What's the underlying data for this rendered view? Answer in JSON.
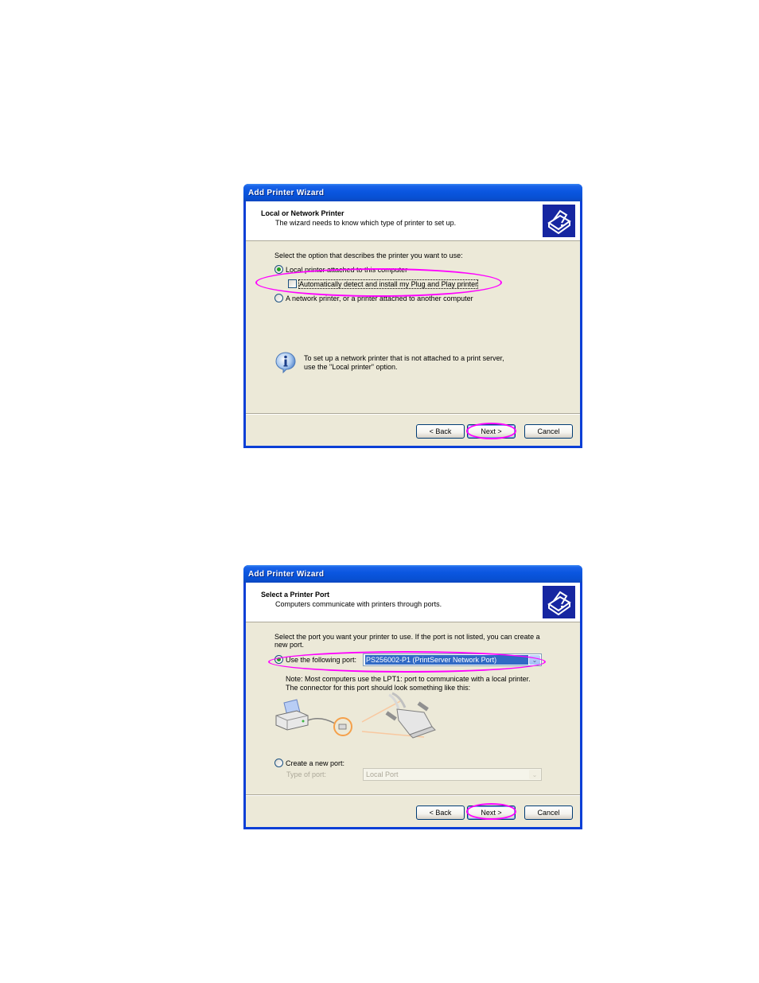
{
  "dialogs": [
    {
      "window_title": "Add Printer Wizard",
      "header": {
        "title": "Local or Network Printer",
        "subtitle": "The wizard needs to know which type of printer to set up."
      },
      "prompt": "Select the option that describes the printer you want to use:",
      "options": [
        {
          "label": "Local printer attached to this computer",
          "type": "radio",
          "checked": true
        },
        {
          "label": "Automatically detect and install my Plug and Play printer",
          "type": "checkbox",
          "checked": false
        },
        {
          "label": "A network printer, or a printer attached to another computer",
          "type": "radio",
          "checked": false
        }
      ],
      "info_text_line1": "To set up a network printer that is not attached to a print server,",
      "info_text_line2": "use the \"Local printer\" option.",
      "buttons": {
        "back": "< Back",
        "next": "Next >",
        "cancel": "Cancel"
      }
    },
    {
      "window_title": "Add Printer Wizard",
      "header": {
        "title": "Select a Printer Port",
        "subtitle": "Computers communicate with printers through ports."
      },
      "prompt_line1": "Select the port you want your printer to use.  If the port is not listed, you can create a",
      "prompt_line2": "new port.",
      "use_port": {
        "label": "Use the following port:",
        "checked": true,
        "selected_value": "PS256002-P1 (PrintServer Network Port)"
      },
      "note_line1": "Note: Most computers use the LPT1: port to communicate with a local printer.",
      "note_line2": "The connector for this port should look something like this:",
      "create_port": {
        "label": "Create a new port:",
        "checked": false,
        "type_label": "Type of port:",
        "type_value": "Local Port"
      },
      "buttons": {
        "back": "< Back",
        "next": "Next >",
        "cancel": "Cancel"
      }
    }
  ],
  "annotation_color": "#ff00ff"
}
